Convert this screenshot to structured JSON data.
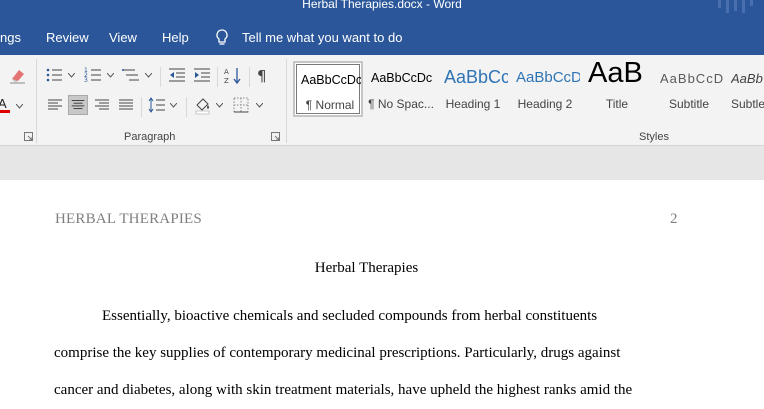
{
  "window": {
    "title": "Herbal Therapies.docx  -  Word"
  },
  "menu": {
    "items": [
      "ngs",
      "Review",
      "View",
      "Help"
    ],
    "tell_me": "Tell me what you want to do"
  },
  "ribbon": {
    "groups": {
      "paragraph": "Paragraph",
      "styles": "Styles"
    },
    "styles": [
      {
        "preview": "AaBbCcDc",
        "name": "¶ Normal"
      },
      {
        "preview": "AaBbCcDc",
        "name": "¶ No Spac..."
      },
      {
        "preview": "AaBbCc",
        "name": "Heading 1"
      },
      {
        "preview": "AaBbCcD",
        "name": "Heading 2"
      },
      {
        "preview": "AaB",
        "name": "Title"
      },
      {
        "preview": "AaBbCcD",
        "name": "Subtitle"
      },
      {
        "preview": "AaBb",
        "name": "Subtle"
      }
    ]
  },
  "document": {
    "running_head": "HERBAL THERAPIES",
    "page_number": "2",
    "title": "Herbal Therapies",
    "lines": [
      "Essentially, bioactive chemicals and secluded compounds from herbal constituents",
      "comprise the key supplies of contemporary medicinal prescriptions. Particularly, drugs against",
      "cancer and diabetes, along with skin treatment materials, have upheld the highest ranks amid the"
    ]
  },
  "colors": {
    "title_bar": "#2b579a",
    "ribbon": "#f3f3f3",
    "heading_blue": "#2e74b5",
    "font_red": "#e00000"
  }
}
